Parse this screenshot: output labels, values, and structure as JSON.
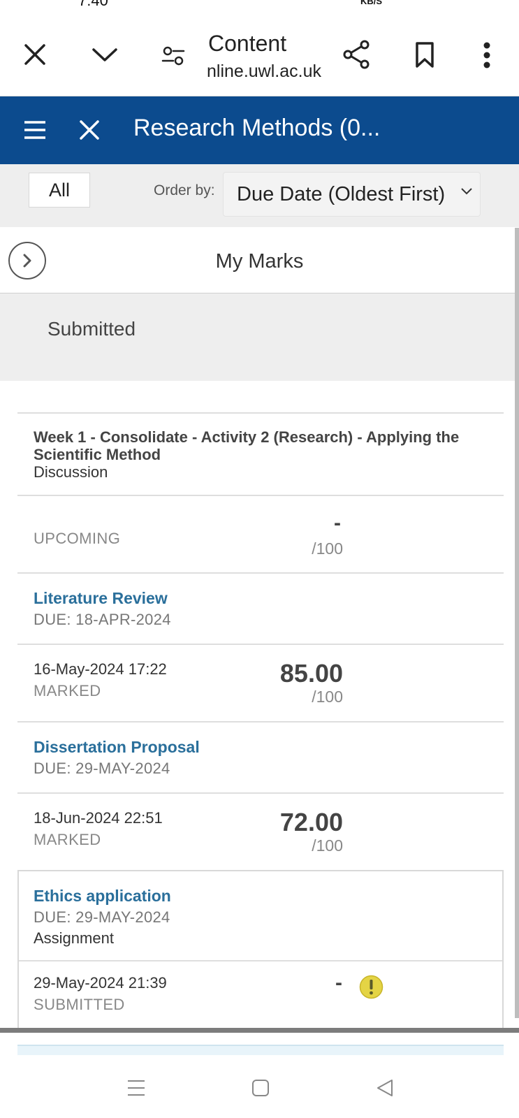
{
  "status_bar": {
    "time": "7:40",
    "net_speed_unit": "KB/S"
  },
  "browser": {
    "page_title": "Content",
    "page_url": "nline.uwl.ac.uk"
  },
  "course": {
    "title": "Research Methods (0..."
  },
  "filter": {
    "all_label": "All",
    "order_label": "Order by:",
    "order_value": "Due Date (Oldest First)"
  },
  "marks": {
    "title": "My Marks",
    "prev_status": "Submitted",
    "items": [
      {
        "title": "Week 1 - Consolidate - Activity 2 (Research) - Applying the Scientific Method",
        "type": "Discussion",
        "status": "UPCOMING",
        "score": "-",
        "max": "/100"
      },
      {
        "title": "Literature Review",
        "due": "DUE: 18-APR-2024",
        "date": "16-May-2024 17:22",
        "status": "MARKED",
        "score": "85.00",
        "max": "/100"
      },
      {
        "title": "Dissertation Proposal",
        "due": "DUE: 29-MAY-2024",
        "date": "18-Jun-2024 22:51",
        "status": "MARKED",
        "score": "72.00",
        "max": "/100"
      },
      {
        "title": "Ethics application",
        "due": "DUE: 29-MAY-2024",
        "type": "Assignment",
        "date": "29-May-2024 21:39",
        "status": "SUBMITTED",
        "score": "-"
      }
    ]
  },
  "icons": {
    "warning": "exclamation-warning-icon",
    "close": "close-icon",
    "menu": "hamburger-menu-icon"
  },
  "colors": {
    "header_blue": "#0c4b8e",
    "link_blue": "#2a6f9b",
    "warning_yellow": "#e4d445"
  }
}
